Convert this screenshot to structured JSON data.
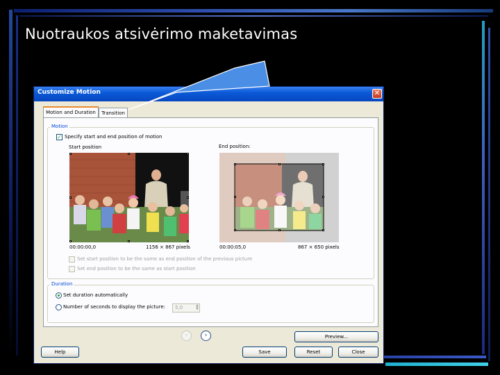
{
  "slide": {
    "title": "Nuotraukos atsivėrimo maketavimas"
  },
  "dialog": {
    "title": "Customize Motion",
    "tabs": [
      {
        "label": "Motion and Duration"
      },
      {
        "label": "Transition"
      }
    ],
    "motion": {
      "legend": "Motion",
      "specify_label": "Specify start and end position of motion",
      "specify_checked": true,
      "start_label": "Start position",
      "end_label": "End position:",
      "start_time": "00:00:00,0",
      "start_size": "1156 × 867 pixels",
      "end_time": "00:00:05,0",
      "end_size": "867 × 650 pixels",
      "same_start_label": "Set start position to be the same as end position of the previous picture",
      "same_end_label": "Set end position to be the same as start position"
    },
    "duration": {
      "legend": "Duration",
      "auto_label": "Set duration automatically",
      "seconds_label": "Number of seconds to display the picture:",
      "seconds_value": "5,0"
    },
    "buttons": {
      "preview": "Preview...",
      "help": "Help",
      "save": "Save",
      "reset": "Reset",
      "close": "Close"
    }
  },
  "colors": {
    "titlebar": "#0a5ad8",
    "callout": "#4a8ee6",
    "legend": "#0046d5"
  }
}
